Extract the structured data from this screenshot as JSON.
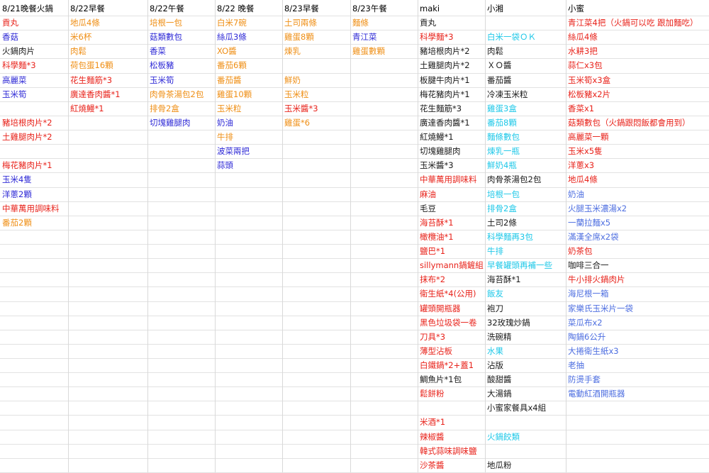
{
  "colors": {
    "black": "#1a1a1a",
    "red": "#e8231b",
    "blue": "#2f2ad6",
    "orange": "#ef8f16",
    "cyan": "#1fc8e8",
    "gray": "#4d6ee0"
  },
  "columns": [
    {
      "header": "8/21晚餐火鍋",
      "items": [
        {
          "t": "貢丸",
          "c": "red"
        },
        {
          "t": "香菇",
          "c": "blue"
        },
        {
          "t": "火鍋肉片",
          "c": "black"
        },
        {
          "t": "科學麵*3",
          "c": "red"
        },
        {
          "t": "高麗菜",
          "c": "blue"
        },
        {
          "t": "玉米筍",
          "c": "blue"
        },
        {
          "t": "",
          "c": "black"
        },
        {
          "t": "豬培根肉片*2",
          "c": "red"
        },
        {
          "t": "土雞腿肉片*2",
          "c": "red"
        },
        {
          "t": "",
          "c": "black"
        },
        {
          "t": "梅花豬肉片*1",
          "c": "red"
        },
        {
          "t": "玉米4隻",
          "c": "blue"
        },
        {
          "t": "洋蔥2顆",
          "c": "blue"
        },
        {
          "t": "中華萬用調味料",
          "c": "red"
        },
        {
          "t": "番茄2顆",
          "c": "orange"
        }
      ]
    },
    {
      "header": "8/22早餐",
      "items": [
        {
          "t": "地瓜4條",
          "c": "orange"
        },
        {
          "t": "米6杯",
          "c": "orange"
        },
        {
          "t": "肉鬆",
          "c": "orange"
        },
        {
          "t": "荷包蛋16顆",
          "c": "orange"
        },
        {
          "t": "花生麵筋*3",
          "c": "red"
        },
        {
          "t": "廣達香肉醬*1",
          "c": "red"
        },
        {
          "t": "紅燒鰻*1",
          "c": "red"
        }
      ]
    },
    {
      "header": "8/22午餐",
      "items": [
        {
          "t": "培根一包",
          "c": "orange"
        },
        {
          "t": "菇類數包",
          "c": "blue"
        },
        {
          "t": "香菜",
          "c": "blue"
        },
        {
          "t": "松板豬",
          "c": "blue"
        },
        {
          "t": "玉米筍",
          "c": "blue"
        },
        {
          "t": "肉骨茶湯包2包",
          "c": "orange"
        },
        {
          "t": "排骨2盒",
          "c": "orange"
        },
        {
          "t": "切塊雞腿肉",
          "c": "blue"
        }
      ]
    },
    {
      "header": "8/22 晚餐",
      "items": [
        {
          "t": "白米7碗",
          "c": "orange"
        },
        {
          "t": "絲瓜3條",
          "c": "blue"
        },
        {
          "t": "XO醬",
          "c": "orange"
        },
        {
          "t": "番茄6顆",
          "c": "orange"
        },
        {
          "t": "番茄醬",
          "c": "orange"
        },
        {
          "t": "雞蛋10顆",
          "c": "orange"
        },
        {
          "t": "玉米粒",
          "c": "orange"
        },
        {
          "t": "奶油",
          "c": "blue"
        },
        {
          "t": "牛排",
          "c": "orange"
        },
        {
          "t": "波菜兩把",
          "c": "blue"
        },
        {
          "t": "蒜頭",
          "c": "blue"
        }
      ]
    },
    {
      "header": "8/23早餐",
      "items": [
        {
          "t": "土司兩條",
          "c": "orange"
        },
        {
          "t": "雞蛋8顆",
          "c": "orange"
        },
        {
          "t": "煉乳",
          "c": "orange"
        },
        {
          "t": "",
          "c": "black"
        },
        {
          "t": "鮮奶",
          "c": "orange"
        },
        {
          "t": "玉米粒",
          "c": "orange"
        },
        {
          "t": "玉米醬*3",
          "c": "red"
        },
        {
          "t": "雞蛋*6",
          "c": "orange"
        }
      ]
    },
    {
      "header": "8/23午餐",
      "items": [
        {
          "t": "麵條",
          "c": "orange"
        },
        {
          "t": "青江菜",
          "c": "blue"
        },
        {
          "t": "雞蛋數顆",
          "c": "orange"
        }
      ]
    },
    {
      "header": "maki",
      "items": [
        {
          "t": "貢丸",
          "c": "black"
        },
        {
          "t": "科學麵*3",
          "c": "red"
        },
        {
          "t": "豬培根肉片*2",
          "c": "black"
        },
        {
          "t": "土雞腿肉片*2",
          "c": "black"
        },
        {
          "t": "板腱牛肉片*1",
          "c": "black"
        },
        {
          "t": "梅花豬肉片*1",
          "c": "black"
        },
        {
          "t": "花生麵筋*3",
          "c": "black"
        },
        {
          "t": "廣達香肉醬*1",
          "c": "black"
        },
        {
          "t": "紅燒鰻*1",
          "c": "black"
        },
        {
          "t": "切塊雞腿肉",
          "c": "black"
        },
        {
          "t": "玉米醬*3",
          "c": "black"
        },
        {
          "t": "中華萬用調味料",
          "c": "red"
        },
        {
          "t": "麻油",
          "c": "red"
        },
        {
          "t": "毛豆",
          "c": "black"
        },
        {
          "t": "海苔酥*1",
          "c": "red"
        },
        {
          "t": "橄欖油*1",
          "c": "red"
        },
        {
          "t": "鹽巴*1",
          "c": "red"
        },
        {
          "t": "sillymann鍋鏟組",
          "c": "red"
        },
        {
          "t": "抹布*2",
          "c": "red"
        },
        {
          "t": "衛生紙*4(公用)",
          "c": "red"
        },
        {
          "t": "罐頭開瓶器",
          "c": "red"
        },
        {
          "t": "黑色垃圾袋一卷",
          "c": "red"
        },
        {
          "t": "刀具*3",
          "c": "red"
        },
        {
          "t": "薄型沾板",
          "c": "red"
        },
        {
          "t": "白鐵鍋*2+蓋1",
          "c": "red"
        },
        {
          "t": "鯛魚片*1包",
          "c": "black"
        },
        {
          "t": "鬆餅粉",
          "c": "red"
        },
        {
          "t": "",
          "c": "black"
        },
        {
          "t": "米酒*1",
          "c": "red"
        },
        {
          "t": "辣椒醬",
          "c": "red"
        },
        {
          "t": "韓式蒜味調味鹽",
          "c": "red"
        },
        {
          "t": "沙茶醬",
          "c": "red"
        }
      ]
    },
    {
      "header": "小湘",
      "items": [
        {
          "t": "",
          "c": "black"
        },
        {
          "t": "白米一袋ＯＫ",
          "c": "cyan"
        },
        {
          "t": "肉鬆",
          "c": "black"
        },
        {
          "t": "ＸＯ醬",
          "c": "black"
        },
        {
          "t": "番茄醬",
          "c": "black"
        },
        {
          "t": "冷凍玉米粒",
          "c": "black"
        },
        {
          "t": "雞蛋3盒",
          "c": "cyan"
        },
        {
          "t": "番茄8顆",
          "c": "cyan"
        },
        {
          "t": "麵條數包",
          "c": "cyan"
        },
        {
          "t": "煉乳一瓶",
          "c": "cyan"
        },
        {
          "t": "鮮奶4瓶",
          "c": "cyan"
        },
        {
          "t": "肉骨茶湯包2包",
          "c": "black"
        },
        {
          "t": "培根一包",
          "c": "cyan"
        },
        {
          "t": "排骨2盒",
          "c": "cyan"
        },
        {
          "t": "土司2條",
          "c": "black"
        },
        {
          "t": "科學麵再3包",
          "c": "cyan"
        },
        {
          "t": "牛排",
          "c": "cyan"
        },
        {
          "t": "早餐罐頭再補一些",
          "c": "cyan"
        },
        {
          "t": "海苔酥*1",
          "c": "black"
        },
        {
          "t": "飯友",
          "c": "cyan"
        },
        {
          "t": "袍刀",
          "c": "black"
        },
        {
          "t": "32玫瑰炒鍋",
          "c": "black"
        },
        {
          "t": "洗碗精",
          "c": "black"
        },
        {
          "t": "水果",
          "c": "cyan"
        },
        {
          "t": "沾版",
          "c": "black"
        },
        {
          "t": "酸甜醬",
          "c": "black"
        },
        {
          "t": "大湯鍋",
          "c": "black"
        },
        {
          "t": "小蜜家餐具x4組",
          "c": "black"
        },
        {
          "t": "",
          "c": "black"
        },
        {
          "t": "火鍋餃類",
          "c": "cyan"
        },
        {
          "t": "",
          "c": "black"
        },
        {
          "t": "地瓜粉",
          "c": "black"
        }
      ]
    },
    {
      "header": "小蜜",
      "items": [
        {
          "t": "青江菜4把（火鍋可以吃 跟加麵吃）",
          "c": "red"
        },
        {
          "t": "絲瓜4條",
          "c": "red"
        },
        {
          "t": "水耕3把",
          "c": "red"
        },
        {
          "t": "蒜仁x3包",
          "c": "red"
        },
        {
          "t": "玉米筍x3盒",
          "c": "red"
        },
        {
          "t": "松板豬x2片",
          "c": "red"
        },
        {
          "t": "香菜x1",
          "c": "red"
        },
        {
          "t": "菇類數包（火鍋跟悶飯都會用到）",
          "c": "red"
        },
        {
          "t": "高麗菜一顆",
          "c": "red"
        },
        {
          "t": "玉米x5隻",
          "c": "red"
        },
        {
          "t": "洋蔥x3",
          "c": "red"
        },
        {
          "t": "地瓜4條",
          "c": "red"
        },
        {
          "t": "奶油",
          "c": "gray"
        },
        {
          "t": "火腿玉米濃湯x2",
          "c": "gray"
        },
        {
          "t": "一蘭拉麵x5",
          "c": "gray"
        },
        {
          "t": "滿漢全席x2袋",
          "c": "gray"
        },
        {
          "t": "奶茶包",
          "c": "red"
        },
        {
          "t": "咖啡三合一",
          "c": "black"
        },
        {
          "t": "牛小排火鍋肉片",
          "c": "red"
        },
        {
          "t": "海尼根一箱",
          "c": "gray"
        },
        {
          "t": "家樂氏玉米片一袋",
          "c": "gray"
        },
        {
          "t": "菜瓜布x2",
          "c": "gray"
        },
        {
          "t": "陶鍋6公升",
          "c": "gray"
        },
        {
          "t": "大捲衛生紙x3",
          "c": "gray"
        },
        {
          "t": "老抽",
          "c": "gray"
        },
        {
          "t": "防燙手套",
          "c": "gray"
        },
        {
          "t": "電動紅酒開瓶器",
          "c": "gray"
        }
      ]
    }
  ]
}
